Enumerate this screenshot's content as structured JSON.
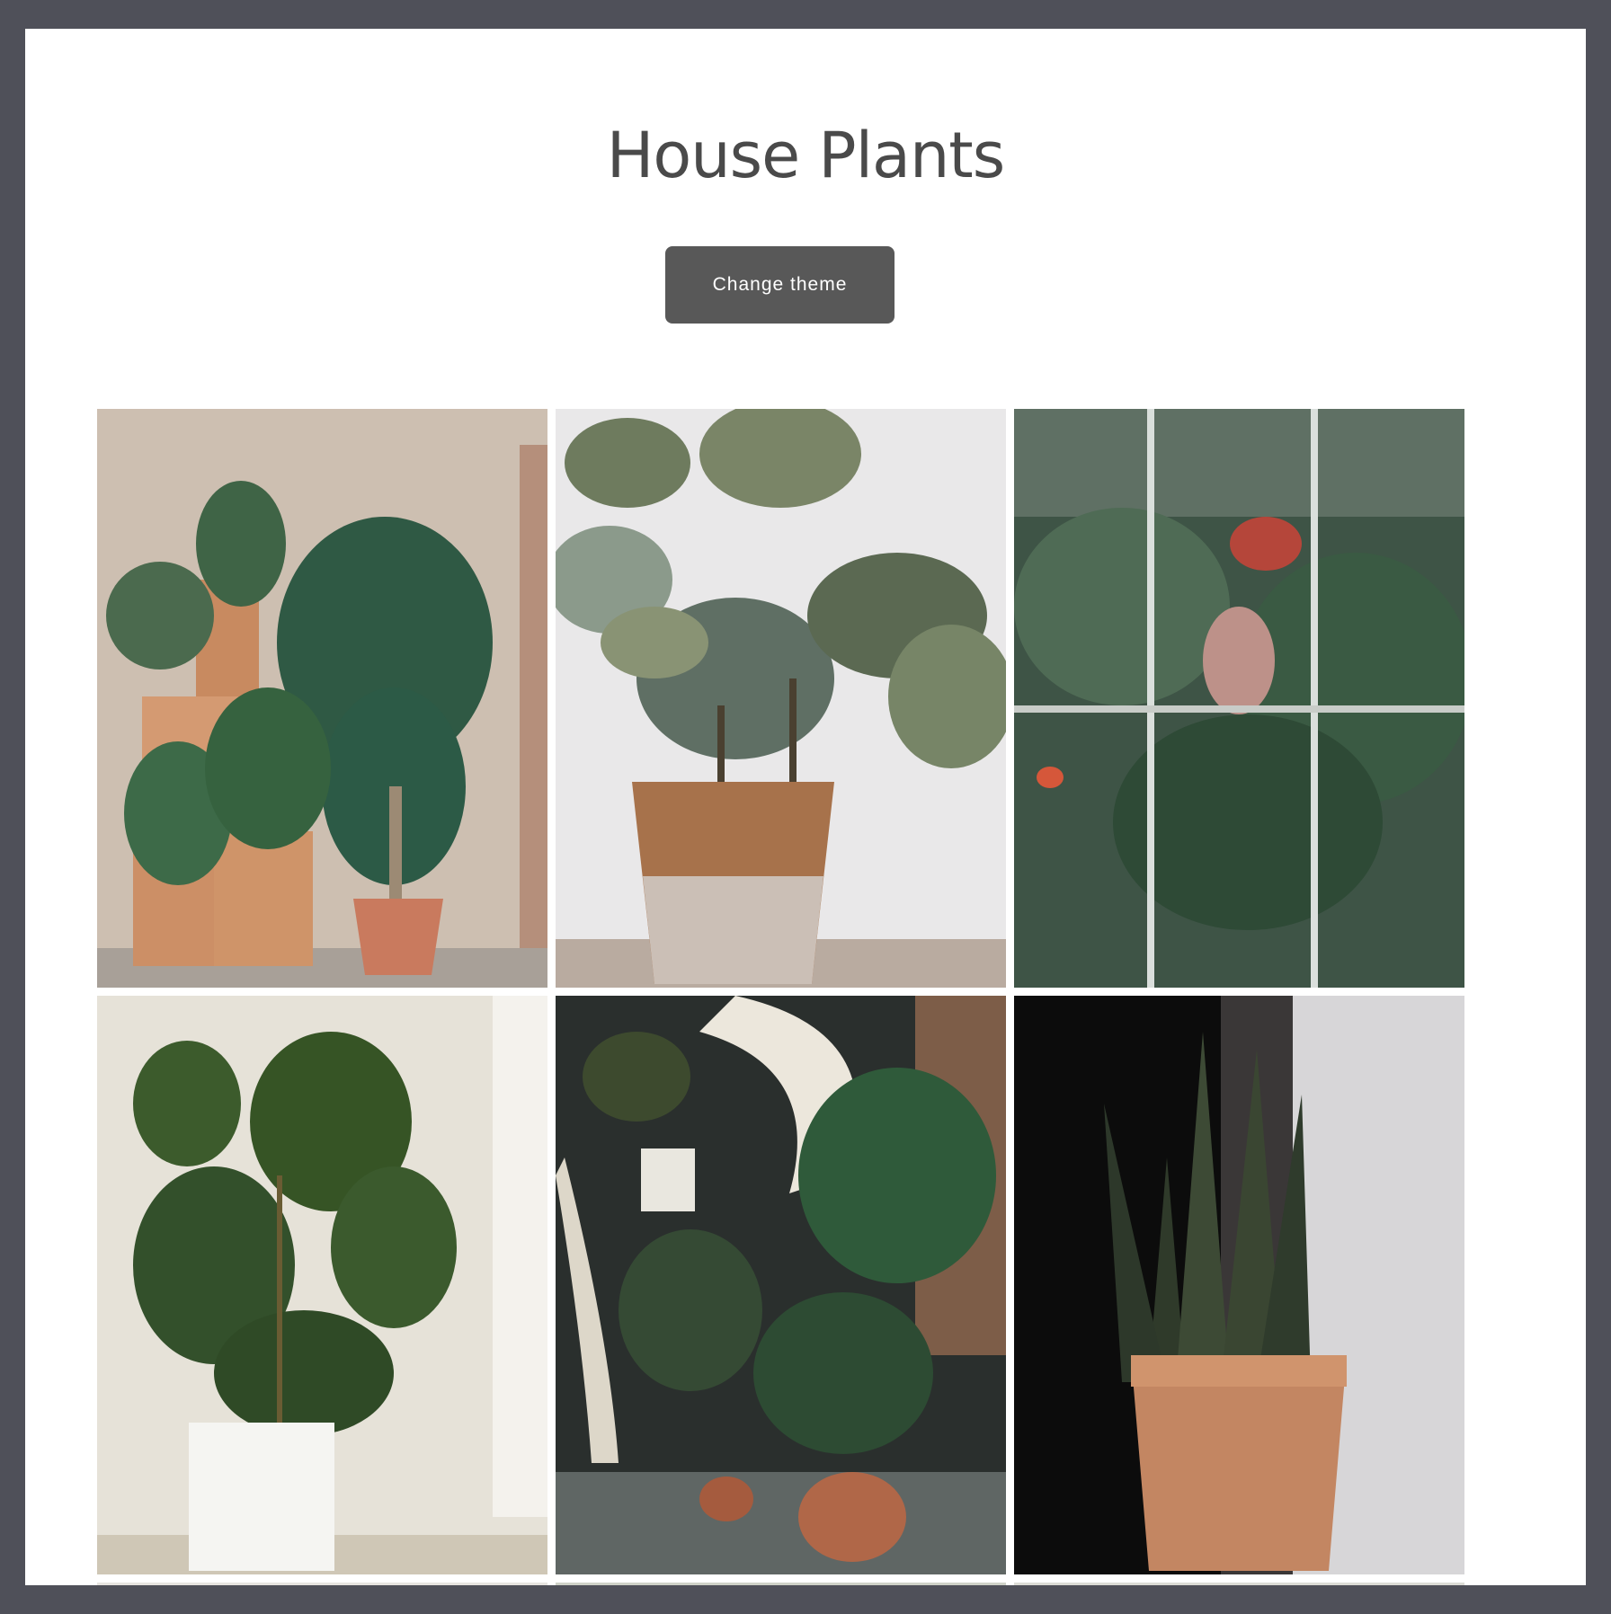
{
  "header": {
    "title": "House Plants"
  },
  "controls": {
    "change_theme_label": "Change theme"
  },
  "gallery": {
    "images": [
      {
        "subject": "plants-on-wooden-crates-photo"
      },
      {
        "subject": "rubber-plant-terracotta-pot-photo"
      },
      {
        "subject": "greenhouse-window-photo"
      },
      {
        "subject": "ficus-white-pot-photo"
      },
      {
        "subject": "spiral-staircase-plants-photo"
      },
      {
        "subject": "snake-plant-photo"
      }
    ]
  },
  "colors": {
    "frame": "#4f5059",
    "page": "#ffffff",
    "button": "#585858",
    "title": "#4a4a4a"
  }
}
